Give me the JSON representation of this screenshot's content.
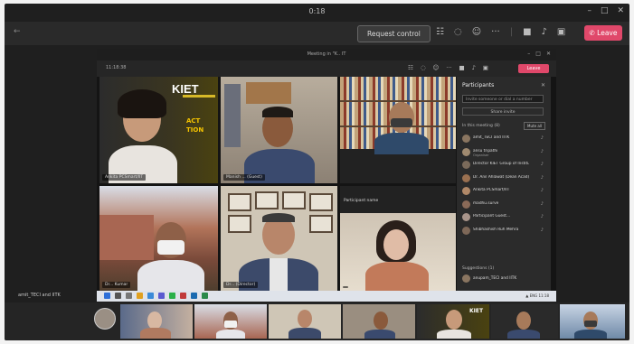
{
  "app": {
    "title": "0:18",
    "toolbar": {
      "request_control": "Request control",
      "leave": "Leave"
    }
  },
  "inner": {
    "title": "Meeting in \"K.. IT",
    "time": "11:18:38",
    "leave": "Leave"
  },
  "tiles": [
    {
      "label": "Ankita PCSmart/IIT"
    },
    {
      "label": "Manish ... (Guest)"
    },
    {
      "label": ""
    },
    {
      "label": "Dr... Kumar"
    },
    {
      "label": "Dr... (Director)"
    },
    {
      "label": ""
    }
  ],
  "slide": {
    "logo": "KIET",
    "line1": "ACT",
    "line2": "TION",
    "right1": "App... ARCH",
    "right2": "One"
  },
  "panel": {
    "title": "Participants",
    "invite_placeholder": "Invite someone or dial a number",
    "share": "Share invite",
    "in_meeting": "In this meeting (8)",
    "mute_all": "Mute all",
    "participants": [
      {
        "name": "amit_TECI and IITK",
        "sub": ""
      },
      {
        "name": "ansu tripathi",
        "sub": "Organiser"
      },
      {
        "name": "Director KIET Group of Institu...",
        "sub": ""
      },
      {
        "name": "Dr. Anil Ahlawat (Dean Acad)...",
        "sub": ""
      },
      {
        "name": "Ankita PCSmart/IIT",
        "sub": ""
      },
      {
        "name": "madhu.surve",
        "sub": ""
      },
      {
        "name": "Participant Guest...",
        "sub": ""
      },
      {
        "name": "Shibhashish Ruh Mehra",
        "sub": ""
      }
    ],
    "lobby": "Suggestions (1)",
    "lobby_name": "anupam_TECI and IITK"
  },
  "side_label": "amit_TECI and IITK",
  "colors": {
    "leave": "#e0486a",
    "panel": "#2b2b2b",
    "frame": "#1f1f1f"
  }
}
